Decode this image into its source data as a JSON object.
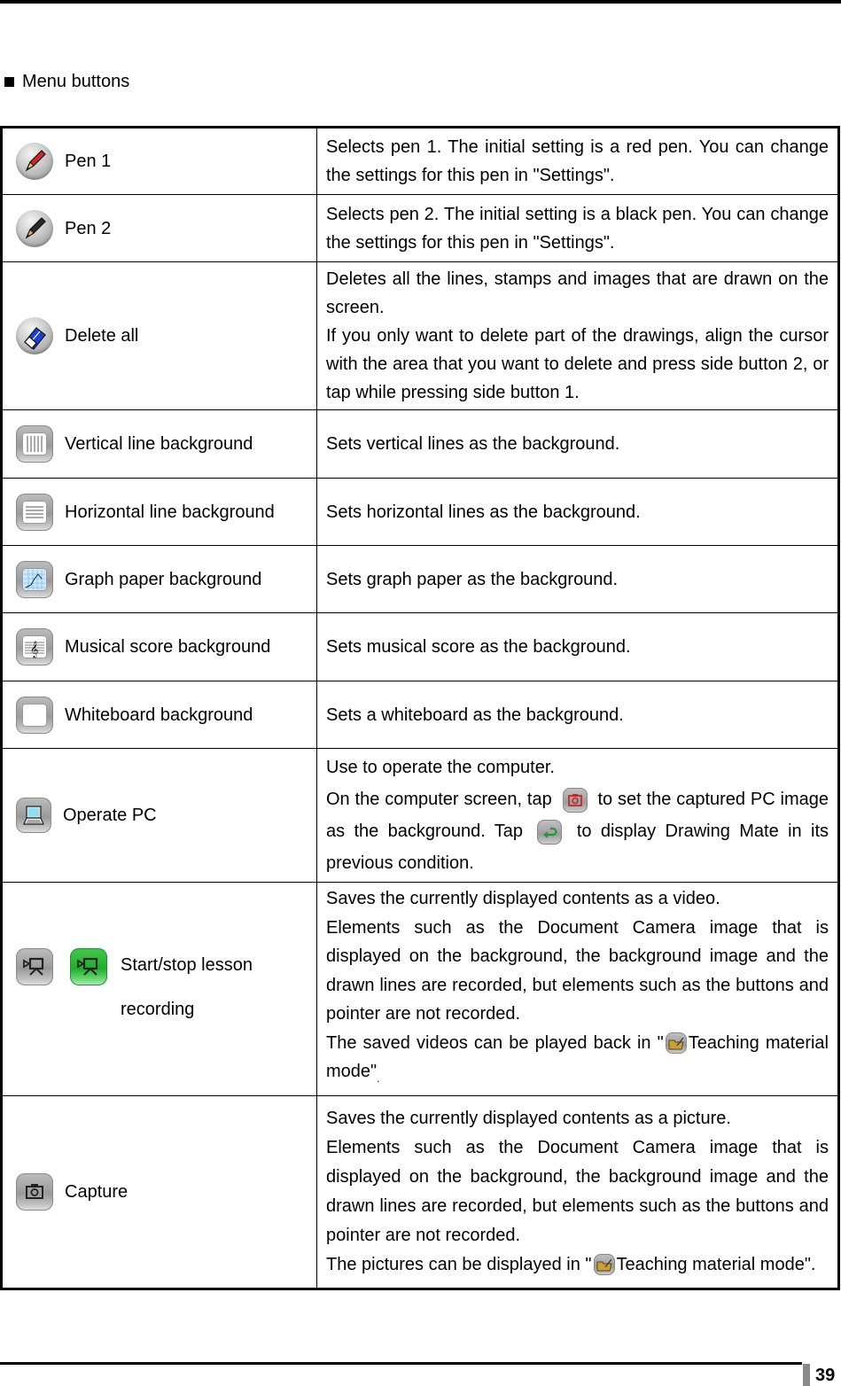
{
  "section": {
    "bullet_icon": "filled-square",
    "title": "Menu buttons"
  },
  "rows": [
    {
      "icon": "red-pencil-icon",
      "label": "Pen 1",
      "description": [
        "Selects pen 1. The initial setting is a red pen. You can change the settings for this pen in \"Settings\"."
      ]
    },
    {
      "icon": "black-pencil-icon",
      "label": "Pen 2",
      "description": [
        "Selects pen 2. The initial setting is a black pen. You can change the settings for this pen in \"Settings\"."
      ]
    },
    {
      "icon": "eraser-icon",
      "label": "Delete all",
      "description": [
        "Deletes all the lines, stamps and images that are drawn on the screen.",
        "If you only want to delete part of the drawings, align the cursor with the area that you want to delete and press side button 2, or tap while pressing side button 1."
      ]
    },
    {
      "icon": "vertical-lines-icon",
      "label": "Vertical line background",
      "description": [
        "Sets vertical lines as the background."
      ]
    },
    {
      "icon": "horizontal-lines-icon",
      "label": "Horizontal line background",
      "description": [
        "Sets horizontal lines as the background."
      ]
    },
    {
      "icon": "graph-paper-icon",
      "label": "Graph paper background",
      "description": [
        "Sets graph paper as the background."
      ]
    },
    {
      "icon": "musical-score-icon",
      "label": "Musical score background",
      "description": [
        "Sets musical score as the background."
      ]
    },
    {
      "icon": "whiteboard-icon",
      "label": "Whiteboard background",
      "description": [
        "Sets a whiteboard as the background."
      ]
    },
    {
      "icon": "laptop-icon",
      "label": "Operate PC",
      "description": {
        "line1": "Use to operate the computer.",
        "part_a": "On the computer screen, tap",
        "inline_icon_1": "camera-capture-icon",
        "part_b": "to set the captured PC image as the background. Tap",
        "inline_icon_2": "return-arrow-icon",
        "part_c": "to display Drawing Mate in its previous condition."
      }
    },
    {
      "icons": [
        "video-camera-icon",
        "video-camera-recording-icon"
      ],
      "label_line1": "Start/stop lesson",
      "label_line2": "recording",
      "description": {
        "line1": "Saves the currently displayed contents as a video.",
        "line2": "Elements such as the Document Camera image that is displayed on the background, the background image and the drawn lines are recorded, but elements such as the buttons and pointer are not recorded.",
        "part_a": "The saved videos can be played back in \"",
        "inline_icon": "teaching-material-folder-icon",
        "part_b": "Teaching material mode\"",
        "trailing": "."
      }
    },
    {
      "icon": "camera-icon",
      "label": "Capture",
      "description": {
        "line1": "Saves the currently displayed contents as a picture.",
        "line2": "Elements such as the Document Camera image that is displayed on the background, the background image and the drawn lines are recorded, but elements such as the buttons and pointer are not recorded.",
        "part_a": "The pictures can be displayed in \"",
        "inline_icon": "teaching-material-folder-icon",
        "part_b": "Teaching material mode\"."
      }
    }
  ],
  "footer": {
    "page_number": "39"
  },
  "colors": {
    "rule": "#000000",
    "page_tab": "#8a8a8a",
    "pen1": "#d8252b",
    "eraser": "#1a3fe0",
    "record_green": "#1fae2d"
  }
}
